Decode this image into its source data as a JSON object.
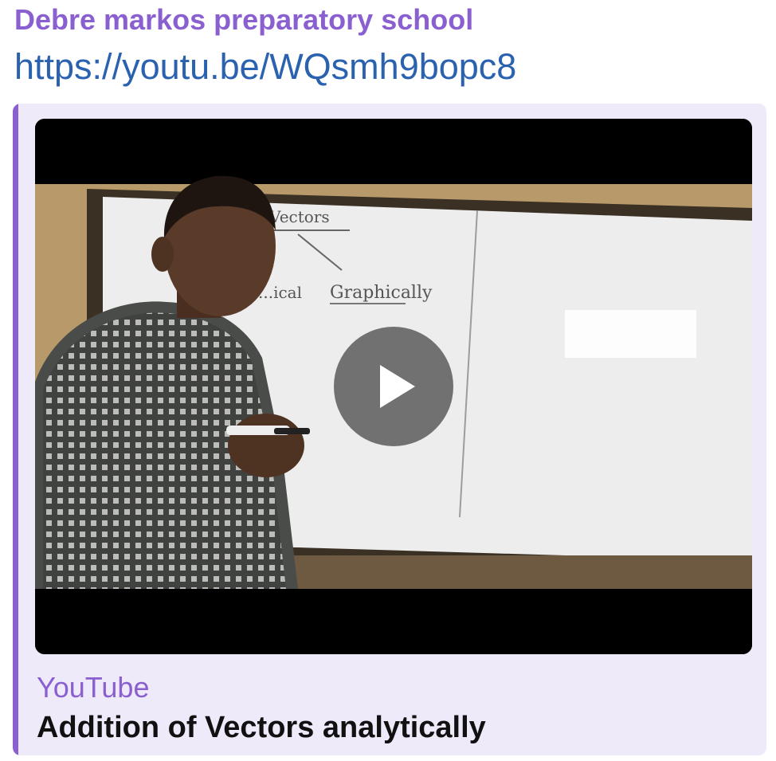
{
  "message": {
    "sender": "Debre markos preparatory school",
    "link_text": "https://youtu.be/WQsmh9bopc8"
  },
  "preview": {
    "site_name": "YouTube",
    "video_title": "Addition of Vectors analytically",
    "thumbnail_board_text": {
      "line1": "1 Vectors",
      "line2_left": "...ical",
      "line2_right": "Graphically"
    },
    "play_icon": "play-icon"
  },
  "colors": {
    "accent": "#8a5fd0",
    "link": "#2a62b0",
    "preview_bg": "#efeafa",
    "title": "#111111"
  }
}
